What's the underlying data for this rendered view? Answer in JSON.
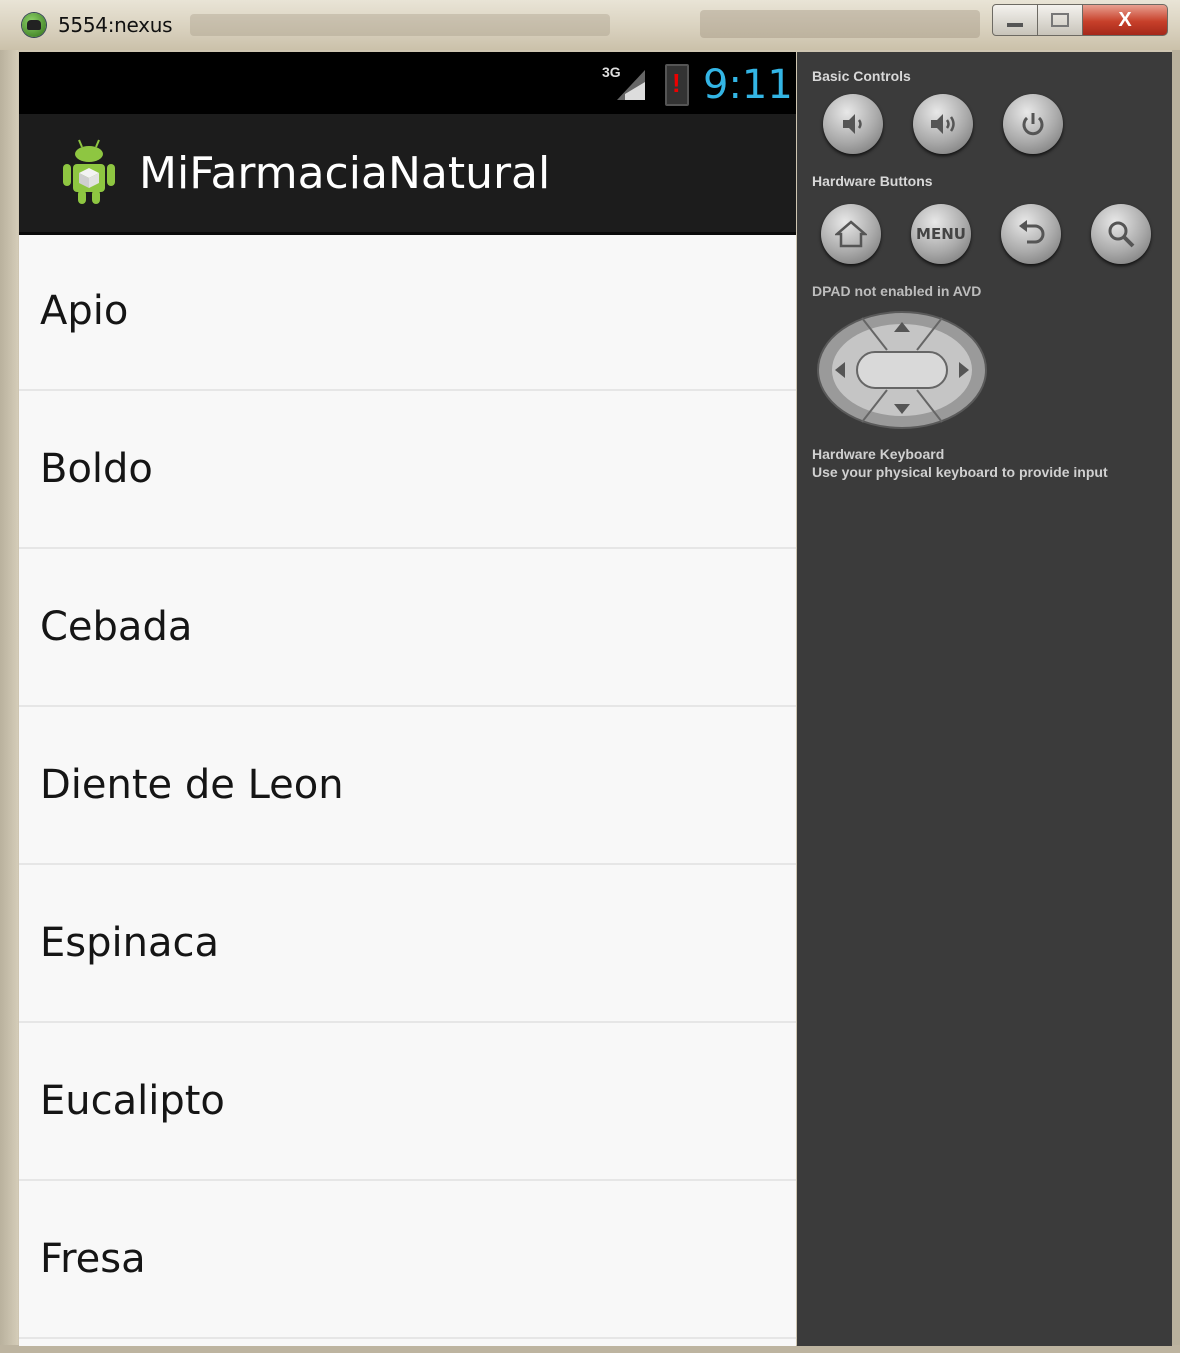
{
  "window": {
    "title": "5554:nexus",
    "close_label": "X"
  },
  "statusbar": {
    "network": "3G",
    "time": "9:11",
    "time_color": "#33b5e5"
  },
  "actionbar": {
    "app_title": "MiFarmaciaNatural",
    "icon": "android-app-icon"
  },
  "list": {
    "items": [
      "Apio",
      "Boldo",
      "Cebada",
      "Diente de Leon",
      "Espinaca",
      "Eucalipto",
      "Fresa"
    ]
  },
  "controls": {
    "basic_label": "Basic Controls",
    "basic_buttons": [
      "volume-down-icon",
      "volume-up-icon",
      "power-icon"
    ],
    "hardware_label": "Hardware Buttons",
    "hardware_buttons": [
      "home-icon",
      "menu",
      "back-icon",
      "search-icon"
    ],
    "menu_label": "MENU",
    "dpad_label": "DPAD not enabled in AVD",
    "keyboard_title": "Hardware Keyboard",
    "keyboard_hint": "Use your physical keyboard to provide input"
  }
}
